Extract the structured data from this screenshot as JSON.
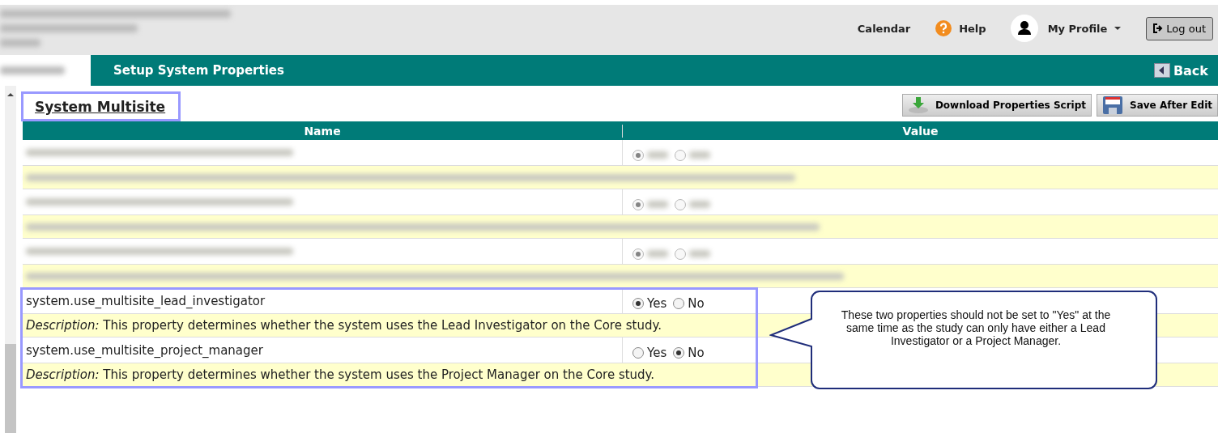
{
  "top_nav": [
    {
      "kind": "link",
      "label": "Calendar"
    },
    {
      "kind": "help",
      "label": "Help"
    },
    {
      "kind": "profile",
      "label": "My Profile"
    },
    {
      "kind": "logout",
      "label": "Log out"
    }
  ],
  "page_title": "Setup System Properties",
  "back_button": "Back",
  "section_title": "System Multisite",
  "toolbar": [
    {
      "kind": "download",
      "label": "Download Properties Script"
    },
    {
      "kind": "save",
      "label": "Save After Edit"
    }
  ],
  "table": {
    "columns": [
      "Name",
      "Value"
    ],
    "rows": [
      {
        "kind": "redacted",
        "options": [
          {
            "selected": true
          },
          {
            "selected": false
          }
        ]
      },
      {
        "kind": "redacted",
        "options": [
          {
            "selected": true
          },
          {
            "selected": false
          }
        ]
      },
      {
        "kind": "redacted",
        "options": [
          {
            "selected": true
          },
          {
            "selected": false
          }
        ]
      },
      {
        "kind": "property",
        "name": "system.use_multisite_lead_investigator",
        "description": "*Description:* This property determines whether the system uses the Lead Investigator on the Core study.",
        "options": [
          {
            "label": "Yes",
            "selected": true
          },
          {
            "label": "No",
            "selected": false
          }
        ]
      },
      {
        "kind": "property",
        "name": "system.use_multisite_project_manager",
        "description": "*Description:* This property determines whether the system uses the Project Manager on the Core study.",
        "options": [
          {
            "label": "Yes",
            "selected": false
          },
          {
            "label": "No",
            "selected": true
          }
        ]
      }
    ]
  },
  "callout": {
    "text": "These two properties should not be set to \"Yes\" at the same time as the study can only have either a Lead Investigator or a Project Manager."
  }
}
